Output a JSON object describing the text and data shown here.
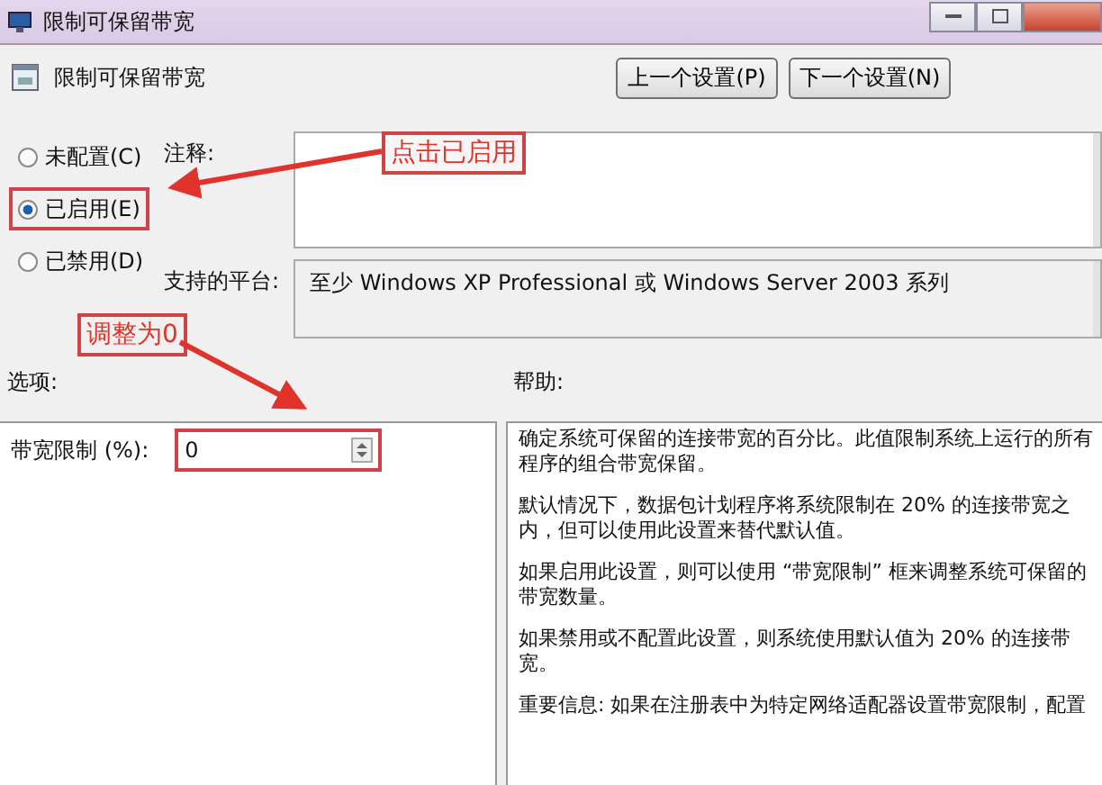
{
  "window": {
    "title": "限制可保留带宽"
  },
  "header": {
    "title": "限制可保留带宽",
    "buttons": [
      "上一个设置(P)",
      "下一个设置(N)"
    ]
  },
  "state_options": [
    {
      "label": "未配置(C)",
      "selected": false,
      "highlighted": false
    },
    {
      "label": "已启用(E)",
      "selected": true,
      "highlighted": true
    },
    {
      "label": "已禁用(D)",
      "selected": false,
      "highlighted": false
    }
  ],
  "comment": {
    "label": "注释:"
  },
  "platform": {
    "label": "支持的平台:",
    "value": "至少 Windows XP Professional 或 Windows Server 2003 系列"
  },
  "options": {
    "label": "选项:",
    "fields": [
      {
        "label": "带宽限制 (%):",
        "value": "0",
        "highlighted": true
      }
    ]
  },
  "help": {
    "label": "帮助:",
    "paragraphs": [
      "确定系统可保留的连接带宽的百分比。此值限制系统上运行的所有程序的组合带宽保留。",
      "默认情况下，数据包计划程序将系统限制在 20% 的连接带宽之内，但可以使用此设置来替代默认值。",
      "如果启用此设置，则可以使用 “带宽限制” 框来调整系统可保留的带宽数量。",
      "如果禁用或不配置此设置，则系统使用默认值为 20% 的连接带宽。",
      "重要信息: 如果在注册表中为特定网络适配器设置带宽限制，配置"
    ]
  },
  "annotations": [
    {
      "kind": "callout",
      "text": "点击已启用"
    },
    {
      "kind": "callout",
      "text": "调整为0"
    }
  ]
}
